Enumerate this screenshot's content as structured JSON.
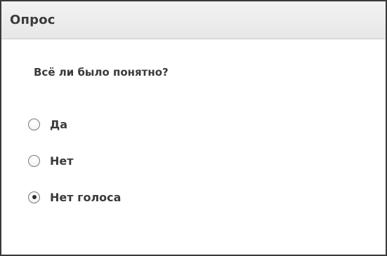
{
  "window": {
    "title": "Опрос"
  },
  "poll": {
    "question": "Всё ли было понятно?",
    "options": [
      {
        "label": "Да",
        "selected": false
      },
      {
        "label": "Нет",
        "selected": false
      },
      {
        "label": "Нет голоса",
        "selected": true
      }
    ]
  }
}
